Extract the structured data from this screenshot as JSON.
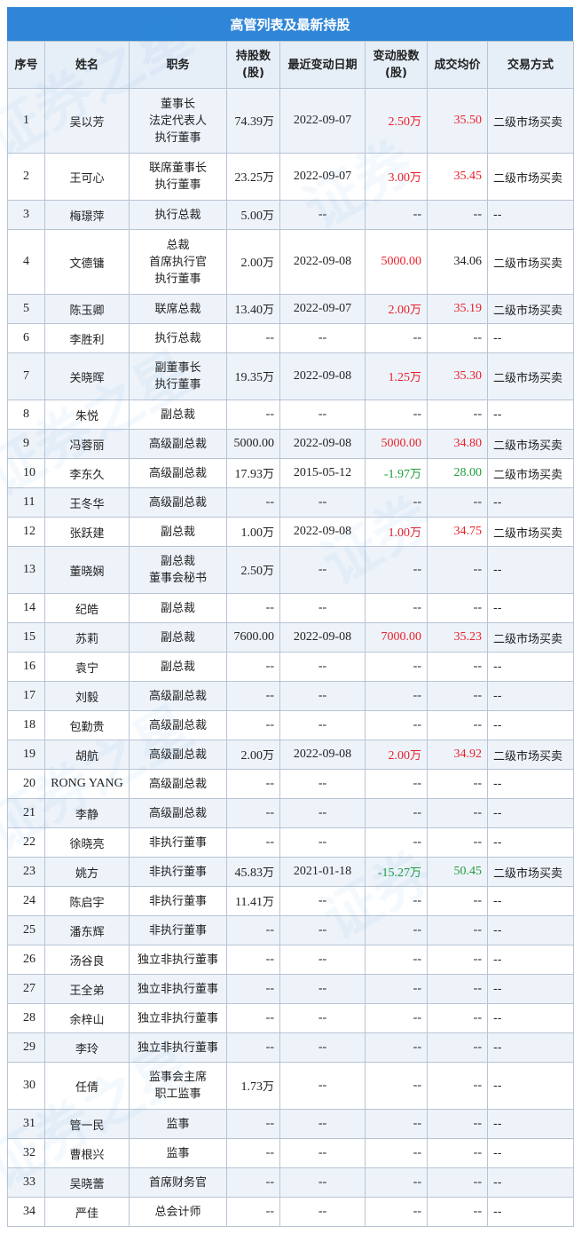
{
  "title": "高管列表及最新持股",
  "colors": {
    "header_bar": "#2f86d8",
    "increase": "#e8202a",
    "decrease": "#1f9e3a"
  },
  "headers": {
    "idx": "序号",
    "name": "姓名",
    "position": "职务",
    "holding_line1": "持股数",
    "holding_line2": "(股)",
    "date": "最近变动日期",
    "change_line1": "变动股数",
    "change_line2": "(股)",
    "price": "成交均价",
    "mode": "交易方式"
  },
  "rows": [
    {
      "idx": "1",
      "name": "吴以芳",
      "position": [
        "董事长",
        "法定代表人",
        "执行董事"
      ],
      "holding": "74.39",
      "holding_unit": "万",
      "date": "2022-09-07",
      "change": "2.50",
      "change_unit": "万",
      "price": "35.50",
      "mode": "二级市场买卖",
      "dir": "up"
    },
    {
      "idx": "2",
      "name": "王可心",
      "position": [
        "联席董事长",
        "执行董事"
      ],
      "holding": "23.25",
      "holding_unit": "万",
      "date": "2022-09-07",
      "change": "3.00",
      "change_unit": "万",
      "price": "35.45",
      "mode": "二级市场买卖",
      "dir": "up"
    },
    {
      "idx": "3",
      "name": "梅璟萍",
      "position": [
        "执行总裁"
      ],
      "holding": "5.00",
      "holding_unit": "万",
      "date": "--",
      "change": "--",
      "change_unit": "",
      "price": "--",
      "mode": "--",
      "dir": ""
    },
    {
      "idx": "4",
      "name": "文德镛",
      "position": [
        "总裁",
        "首席执行官",
        "执行董事"
      ],
      "holding": "2.00",
      "holding_unit": "万",
      "date": "2022-09-08",
      "change": "5000.00",
      "change_unit": "",
      "price": "34.06",
      "mode": "二级市场买卖",
      "dir": "up-dark"
    },
    {
      "idx": "5",
      "name": "陈玉卿",
      "position": [
        "联席总裁"
      ],
      "holding": "13.40",
      "holding_unit": "万",
      "date": "2022-09-07",
      "change": "2.00",
      "change_unit": "万",
      "price": "35.19",
      "mode": "二级市场买卖",
      "dir": "up"
    },
    {
      "idx": "6",
      "name": "李胜利",
      "position": [
        "执行总裁"
      ],
      "holding": "--",
      "holding_unit": "",
      "date": "--",
      "change": "--",
      "change_unit": "",
      "price": "--",
      "mode": "--",
      "dir": ""
    },
    {
      "idx": "7",
      "name": "关晓晖",
      "position": [
        "副董事长",
        "执行董事"
      ],
      "holding": "19.35",
      "holding_unit": "万",
      "date": "2022-09-08",
      "change": "1.25",
      "change_unit": "万",
      "price": "35.30",
      "mode": "二级市场买卖",
      "dir": "up"
    },
    {
      "idx": "8",
      "name": "朱悦",
      "position": [
        "副总裁"
      ],
      "holding": "--",
      "holding_unit": "",
      "date": "--",
      "change": "--",
      "change_unit": "",
      "price": "--",
      "mode": "--",
      "dir": ""
    },
    {
      "idx": "9",
      "name": "冯蓉丽",
      "position": [
        "高级副总裁"
      ],
      "holding": "5000.00",
      "holding_unit": "",
      "date": "2022-09-08",
      "change": "5000.00",
      "change_unit": "",
      "price": "34.80",
      "mode": "二级市场买卖",
      "dir": "up"
    },
    {
      "idx": "10",
      "name": "李东久",
      "position": [
        "高级副总裁"
      ],
      "holding": "17.93",
      "holding_unit": "万",
      "date": "2015-05-12",
      "change": "-1.97",
      "change_unit": "万",
      "price": "28.00",
      "mode": "二级市场买卖",
      "dir": "down"
    },
    {
      "idx": "11",
      "name": "王冬华",
      "position": [
        "高级副总裁"
      ],
      "holding": "--",
      "holding_unit": "",
      "date": "--",
      "change": "--",
      "change_unit": "",
      "price": "--",
      "mode": "--",
      "dir": ""
    },
    {
      "idx": "12",
      "name": "张跃建",
      "position": [
        "副总裁"
      ],
      "holding": "1.00",
      "holding_unit": "万",
      "date": "2022-09-08",
      "change": "1.00",
      "change_unit": "万",
      "price": "34.75",
      "mode": "二级市场买卖",
      "dir": "up"
    },
    {
      "idx": "13",
      "name": "董晓娴",
      "position": [
        "副总裁",
        "董事会秘书"
      ],
      "holding": "2.50",
      "holding_unit": "万",
      "date": "--",
      "change": "--",
      "change_unit": "",
      "price": "--",
      "mode": "--",
      "dir": ""
    },
    {
      "idx": "14",
      "name": "纪皓",
      "position": [
        "副总裁"
      ],
      "holding": "--",
      "holding_unit": "",
      "date": "--",
      "change": "--",
      "change_unit": "",
      "price": "--",
      "mode": "--",
      "dir": ""
    },
    {
      "idx": "15",
      "name": "苏莉",
      "position": [
        "副总裁"
      ],
      "holding": "7600.00",
      "holding_unit": "",
      "date": "2022-09-08",
      "change": "7000.00",
      "change_unit": "",
      "price": "35.23",
      "mode": "二级市场买卖",
      "dir": "up"
    },
    {
      "idx": "16",
      "name": "袁宁",
      "position": [
        "副总裁"
      ],
      "holding": "--",
      "holding_unit": "",
      "date": "--",
      "change": "--",
      "change_unit": "",
      "price": "--",
      "mode": "--",
      "dir": ""
    },
    {
      "idx": "17",
      "name": "刘毅",
      "position": [
        "高级副总裁"
      ],
      "holding": "--",
      "holding_unit": "",
      "date": "--",
      "change": "--",
      "change_unit": "",
      "price": "--",
      "mode": "--",
      "dir": ""
    },
    {
      "idx": "18",
      "name": "包勤贵",
      "position": [
        "高级副总裁"
      ],
      "holding": "--",
      "holding_unit": "",
      "date": "--",
      "change": "--",
      "change_unit": "",
      "price": "--",
      "mode": "--",
      "dir": ""
    },
    {
      "idx": "19",
      "name": "胡航",
      "position": [
        "高级副总裁"
      ],
      "holding": "2.00",
      "holding_unit": "万",
      "date": "2022-09-08",
      "change": "2.00",
      "change_unit": "万",
      "price": "34.92",
      "mode": "二级市场买卖",
      "dir": "up"
    },
    {
      "idx": "20",
      "name": "RONG YANG",
      "position": [
        "高级副总裁"
      ],
      "holding": "--",
      "holding_unit": "",
      "date": "--",
      "change": "--",
      "change_unit": "",
      "price": "--",
      "mode": "--",
      "dir": "",
      "latin": true
    },
    {
      "idx": "21",
      "name": "李静",
      "position": [
        "高级副总裁"
      ],
      "holding": "--",
      "holding_unit": "",
      "date": "--",
      "change": "--",
      "change_unit": "",
      "price": "--",
      "mode": "--",
      "dir": ""
    },
    {
      "idx": "22",
      "name": "徐晓亮",
      "position": [
        "非执行董事"
      ],
      "holding": "--",
      "holding_unit": "",
      "date": "--",
      "change": "--",
      "change_unit": "",
      "price": "--",
      "mode": "--",
      "dir": ""
    },
    {
      "idx": "23",
      "name": "姚方",
      "position": [
        "非执行董事"
      ],
      "holding": "45.83",
      "holding_unit": "万",
      "date": "2021-01-18",
      "change": "-15.27",
      "change_unit": "万",
      "price": "50.45",
      "mode": "二级市场买卖",
      "dir": "down"
    },
    {
      "idx": "24",
      "name": "陈启宇",
      "position": [
        "非执行董事"
      ],
      "holding": "11.41",
      "holding_unit": "万",
      "date": "--",
      "change": "--",
      "change_unit": "",
      "price": "--",
      "mode": "--",
      "dir": ""
    },
    {
      "idx": "25",
      "name": "潘东辉",
      "position": [
        "非执行董事"
      ],
      "holding": "--",
      "holding_unit": "",
      "date": "--",
      "change": "--",
      "change_unit": "",
      "price": "--",
      "mode": "--",
      "dir": ""
    },
    {
      "idx": "26",
      "name": "汤谷良",
      "position": [
        "独立非执行董事"
      ],
      "holding": "--",
      "holding_unit": "",
      "date": "--",
      "change": "--",
      "change_unit": "",
      "price": "--",
      "mode": "--",
      "dir": ""
    },
    {
      "idx": "27",
      "name": "王全弟",
      "position": [
        "独立非执行董事"
      ],
      "holding": "--",
      "holding_unit": "",
      "date": "--",
      "change": "--",
      "change_unit": "",
      "price": "--",
      "mode": "--",
      "dir": ""
    },
    {
      "idx": "28",
      "name": "余梓山",
      "position": [
        "独立非执行董事"
      ],
      "holding": "--",
      "holding_unit": "",
      "date": "--",
      "change": "--",
      "change_unit": "",
      "price": "--",
      "mode": "--",
      "dir": ""
    },
    {
      "idx": "29",
      "name": "李玲",
      "position": [
        "独立非执行董事"
      ],
      "holding": "--",
      "holding_unit": "",
      "date": "--",
      "change": "--",
      "change_unit": "",
      "price": "--",
      "mode": "--",
      "dir": ""
    },
    {
      "idx": "30",
      "name": "任倩",
      "position": [
        "监事会主席",
        "职工监事"
      ],
      "holding": "1.73",
      "holding_unit": "万",
      "date": "--",
      "change": "--",
      "change_unit": "",
      "price": "--",
      "mode": "--",
      "dir": ""
    },
    {
      "idx": "31",
      "name": "管一民",
      "position": [
        "监事"
      ],
      "holding": "--",
      "holding_unit": "",
      "date": "--",
      "change": "--",
      "change_unit": "",
      "price": "--",
      "mode": "--",
      "dir": ""
    },
    {
      "idx": "32",
      "name": "曹根兴",
      "position": [
        "监事"
      ],
      "holding": "--",
      "holding_unit": "",
      "date": "--",
      "change": "--",
      "change_unit": "",
      "price": "--",
      "mode": "--",
      "dir": ""
    },
    {
      "idx": "33",
      "name": "吴晓蕾",
      "position": [
        "首席财务官"
      ],
      "holding": "--",
      "holding_unit": "",
      "date": "--",
      "change": "--",
      "change_unit": "",
      "price": "--",
      "mode": "--",
      "dir": ""
    },
    {
      "idx": "34",
      "name": "严佳",
      "position": [
        "总会计师"
      ],
      "holding": "--",
      "holding_unit": "",
      "date": "--",
      "change": "--",
      "change_unit": "",
      "price": "--",
      "mode": "--",
      "dir": ""
    }
  ]
}
